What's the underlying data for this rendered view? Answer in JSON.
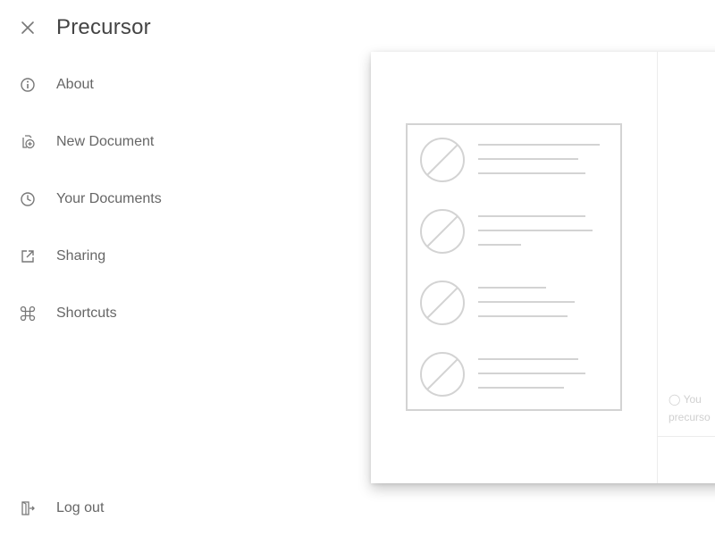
{
  "app": {
    "title": "Precursor"
  },
  "menu": {
    "items": [
      {
        "id": "about",
        "label": "About",
        "icon": "info-icon"
      },
      {
        "id": "new-document",
        "label": "New Document",
        "icon": "new-document-icon"
      },
      {
        "id": "your-documents",
        "label": "Your Documents",
        "icon": "clock-icon"
      },
      {
        "id": "sharing",
        "label": "Sharing",
        "icon": "external-link-icon"
      },
      {
        "id": "shortcuts",
        "label": "Shortcuts",
        "icon": "command-icon"
      }
    ],
    "logout": {
      "label": "Log out",
      "icon": "logout-icon"
    }
  },
  "preview": {
    "note_line1": "You",
    "note_line2": "precurso"
  },
  "colors": {
    "icon": "#777777",
    "illustration": "#d3d3d3",
    "note": "#d0d0d0"
  }
}
